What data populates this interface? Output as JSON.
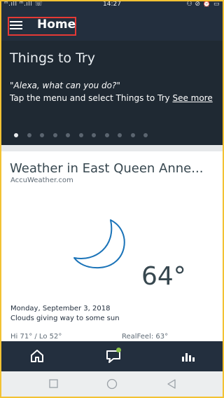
{
  "status_bar": {
    "left": "ᵐ.ıll ᵐ.ıll ☏",
    "time": "14:27",
    "right": "⚇ ⊘ ⏰ ▭"
  },
  "header": {
    "title": "Home",
    "menu_icon": "hamburger-menu-icon"
  },
  "things_to_try": {
    "title": "Things to Try",
    "quote": "\"Alexa, what can you do?\"",
    "body": "Tap the menu and select Things to Try",
    "link": "See more",
    "pages": 11,
    "active_page": 1
  },
  "weather": {
    "title": "Weather in East Queen Anne...",
    "source": "AccuWeather.com",
    "icon": "crescent-moon-icon",
    "temperature": "64°",
    "date": "Monday, September 3, 2018",
    "description": "Clouds giving way to some sun",
    "hi_lo": "Hi 71° / Lo 52°",
    "realfeel": "RealFeel: 63°"
  },
  "tab_bar": {
    "tabs": [
      "home-icon",
      "communicate-icon",
      "play-icon"
    ],
    "notification_color": "#8bc34a"
  },
  "nav_bar": {
    "buttons": [
      "recents-square-icon",
      "home-circle-icon",
      "back-triangle-icon"
    ]
  },
  "colors": {
    "header_bg": "#232f3e",
    "panel_bg": "#1f2933",
    "accent_border": "#f3c233",
    "highlight_box": "#e53935",
    "moon_stroke": "#1a73b8"
  }
}
